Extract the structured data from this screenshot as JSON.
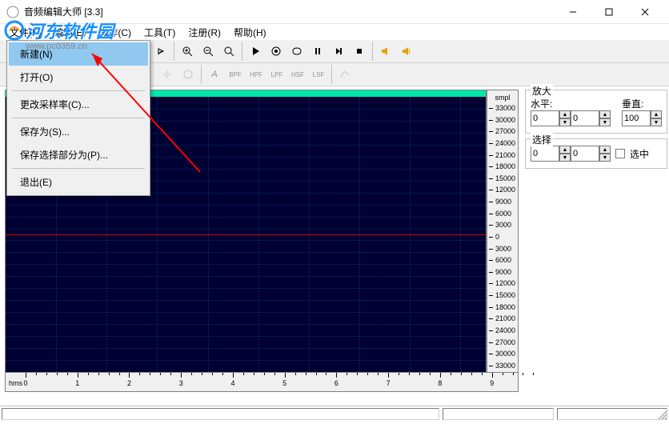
{
  "window": {
    "title": "音频编辑大师  [3.3]"
  },
  "menubar": {
    "file": "文件(F)",
    "edit": "编辑(E)",
    "operate": "操作(C)",
    "tools": "工具(T)",
    "register": "注册(R)",
    "help": "帮助(H)"
  },
  "file_menu": {
    "new": "新建(N)",
    "open": "打开(O)",
    "resample": "更改采样率(C)...",
    "saveas": "保存为(S)...",
    "save_selection": "保存选择部分为(P)...",
    "exit": "退出(E)"
  },
  "toolbar2_filters": [
    "A",
    "BPF",
    "HPF",
    "LPF",
    "HSF",
    "LSF"
  ],
  "y_axis": {
    "header": "smpl",
    "labels": [
      "33000",
      "30000",
      "27000",
      "24000",
      "21000",
      "18000",
      "15000",
      "12000",
      "9000",
      "6000",
      "3000",
      "0",
      "3000",
      "6000",
      "9000",
      "12000",
      "15000",
      "18000",
      "21000",
      "24000",
      "27000",
      "30000",
      "33000"
    ]
  },
  "x_axis": {
    "unit": "hms",
    "labels": [
      "0",
      "1",
      "2",
      "3",
      "4",
      "5",
      "6",
      "7",
      "8",
      "9"
    ]
  },
  "side": {
    "zoom": {
      "legend": "放大",
      "h_label": "水平:",
      "v_label": "垂直:",
      "h_value": "0",
      "v_value": "100"
    },
    "select": {
      "legend": "选择",
      "from": "0",
      "to": "0",
      "checkbox_label": "选中"
    }
  },
  "watermark": {
    "site": "河东软件园",
    "url": "www.pc0359.cn"
  }
}
